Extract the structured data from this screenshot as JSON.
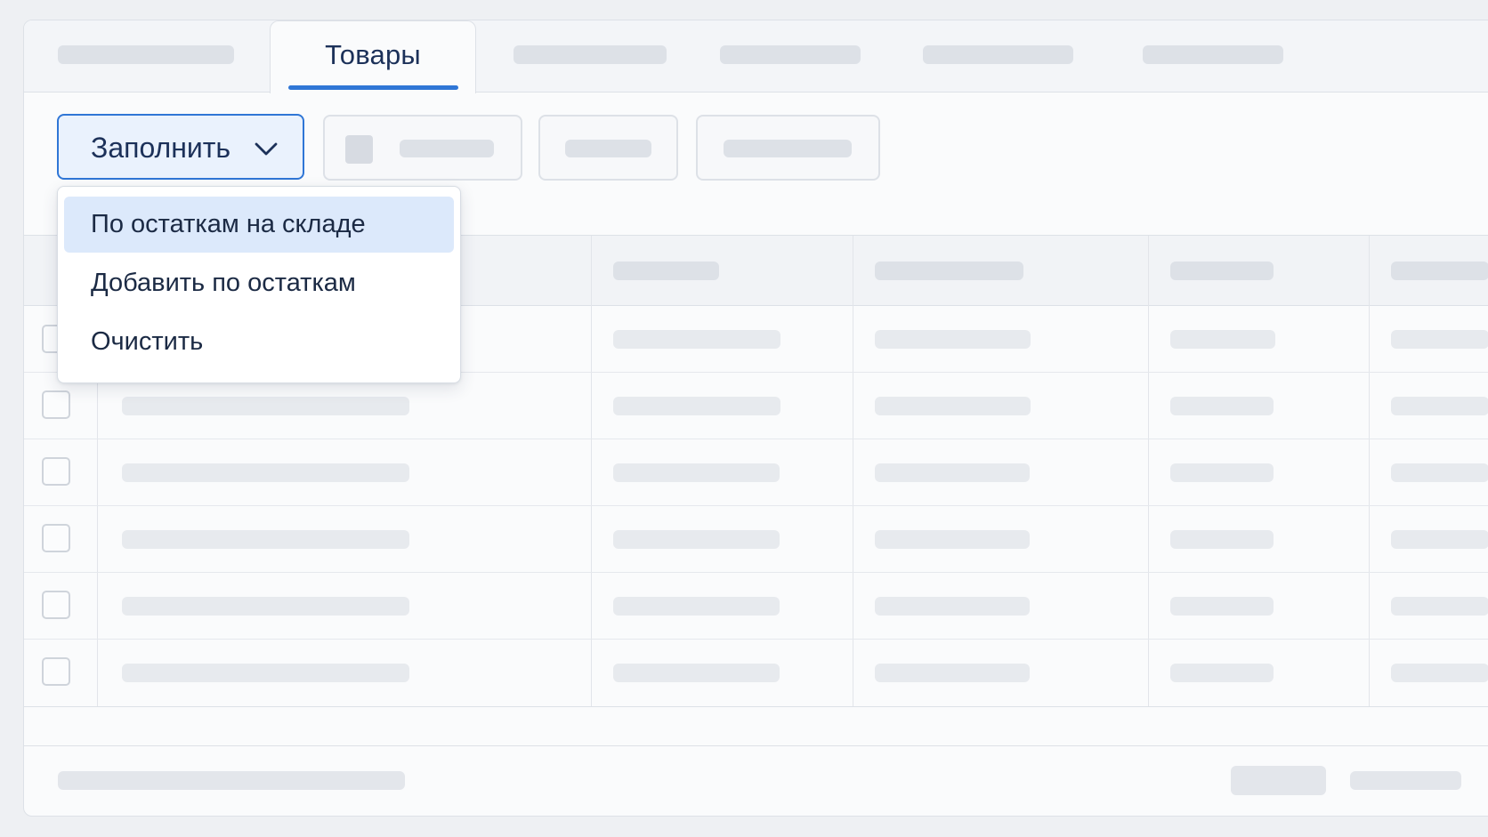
{
  "tabs": {
    "active_label": "Товары"
  },
  "toolbar": {
    "fill_button_label": "Заполнить"
  },
  "fill_menu": {
    "items": [
      {
        "label": "По остаткам на складе",
        "highlighted": true
      },
      {
        "label": "Добавить по остаткам",
        "highlighted": false
      },
      {
        "label": "Очистить",
        "highlighted": false
      }
    ]
  },
  "colors": {
    "accent": "#2f76d6",
    "highlight": "#dce9fb",
    "text": "#1b2a44"
  },
  "icons": {
    "fill_button": "chevron-down-icon"
  }
}
